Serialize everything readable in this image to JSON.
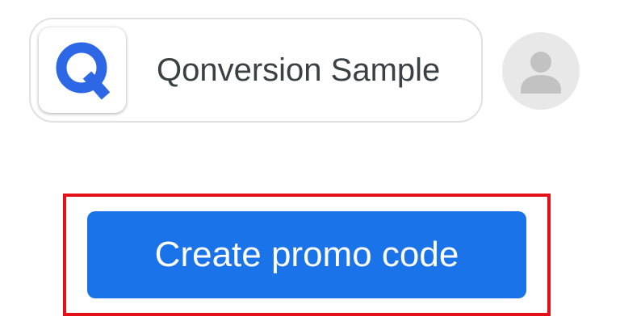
{
  "app": {
    "name": "Qonversion Sample",
    "logo_icon": "qonversion-q-logo",
    "logo_color": "#2e67e6"
  },
  "account": {
    "avatar_icon": "account-avatar-icon"
  },
  "actions": {
    "create_promo_label": "Create promo code",
    "button_color": "#1a73e8",
    "highlight_color": "#e3101a"
  }
}
